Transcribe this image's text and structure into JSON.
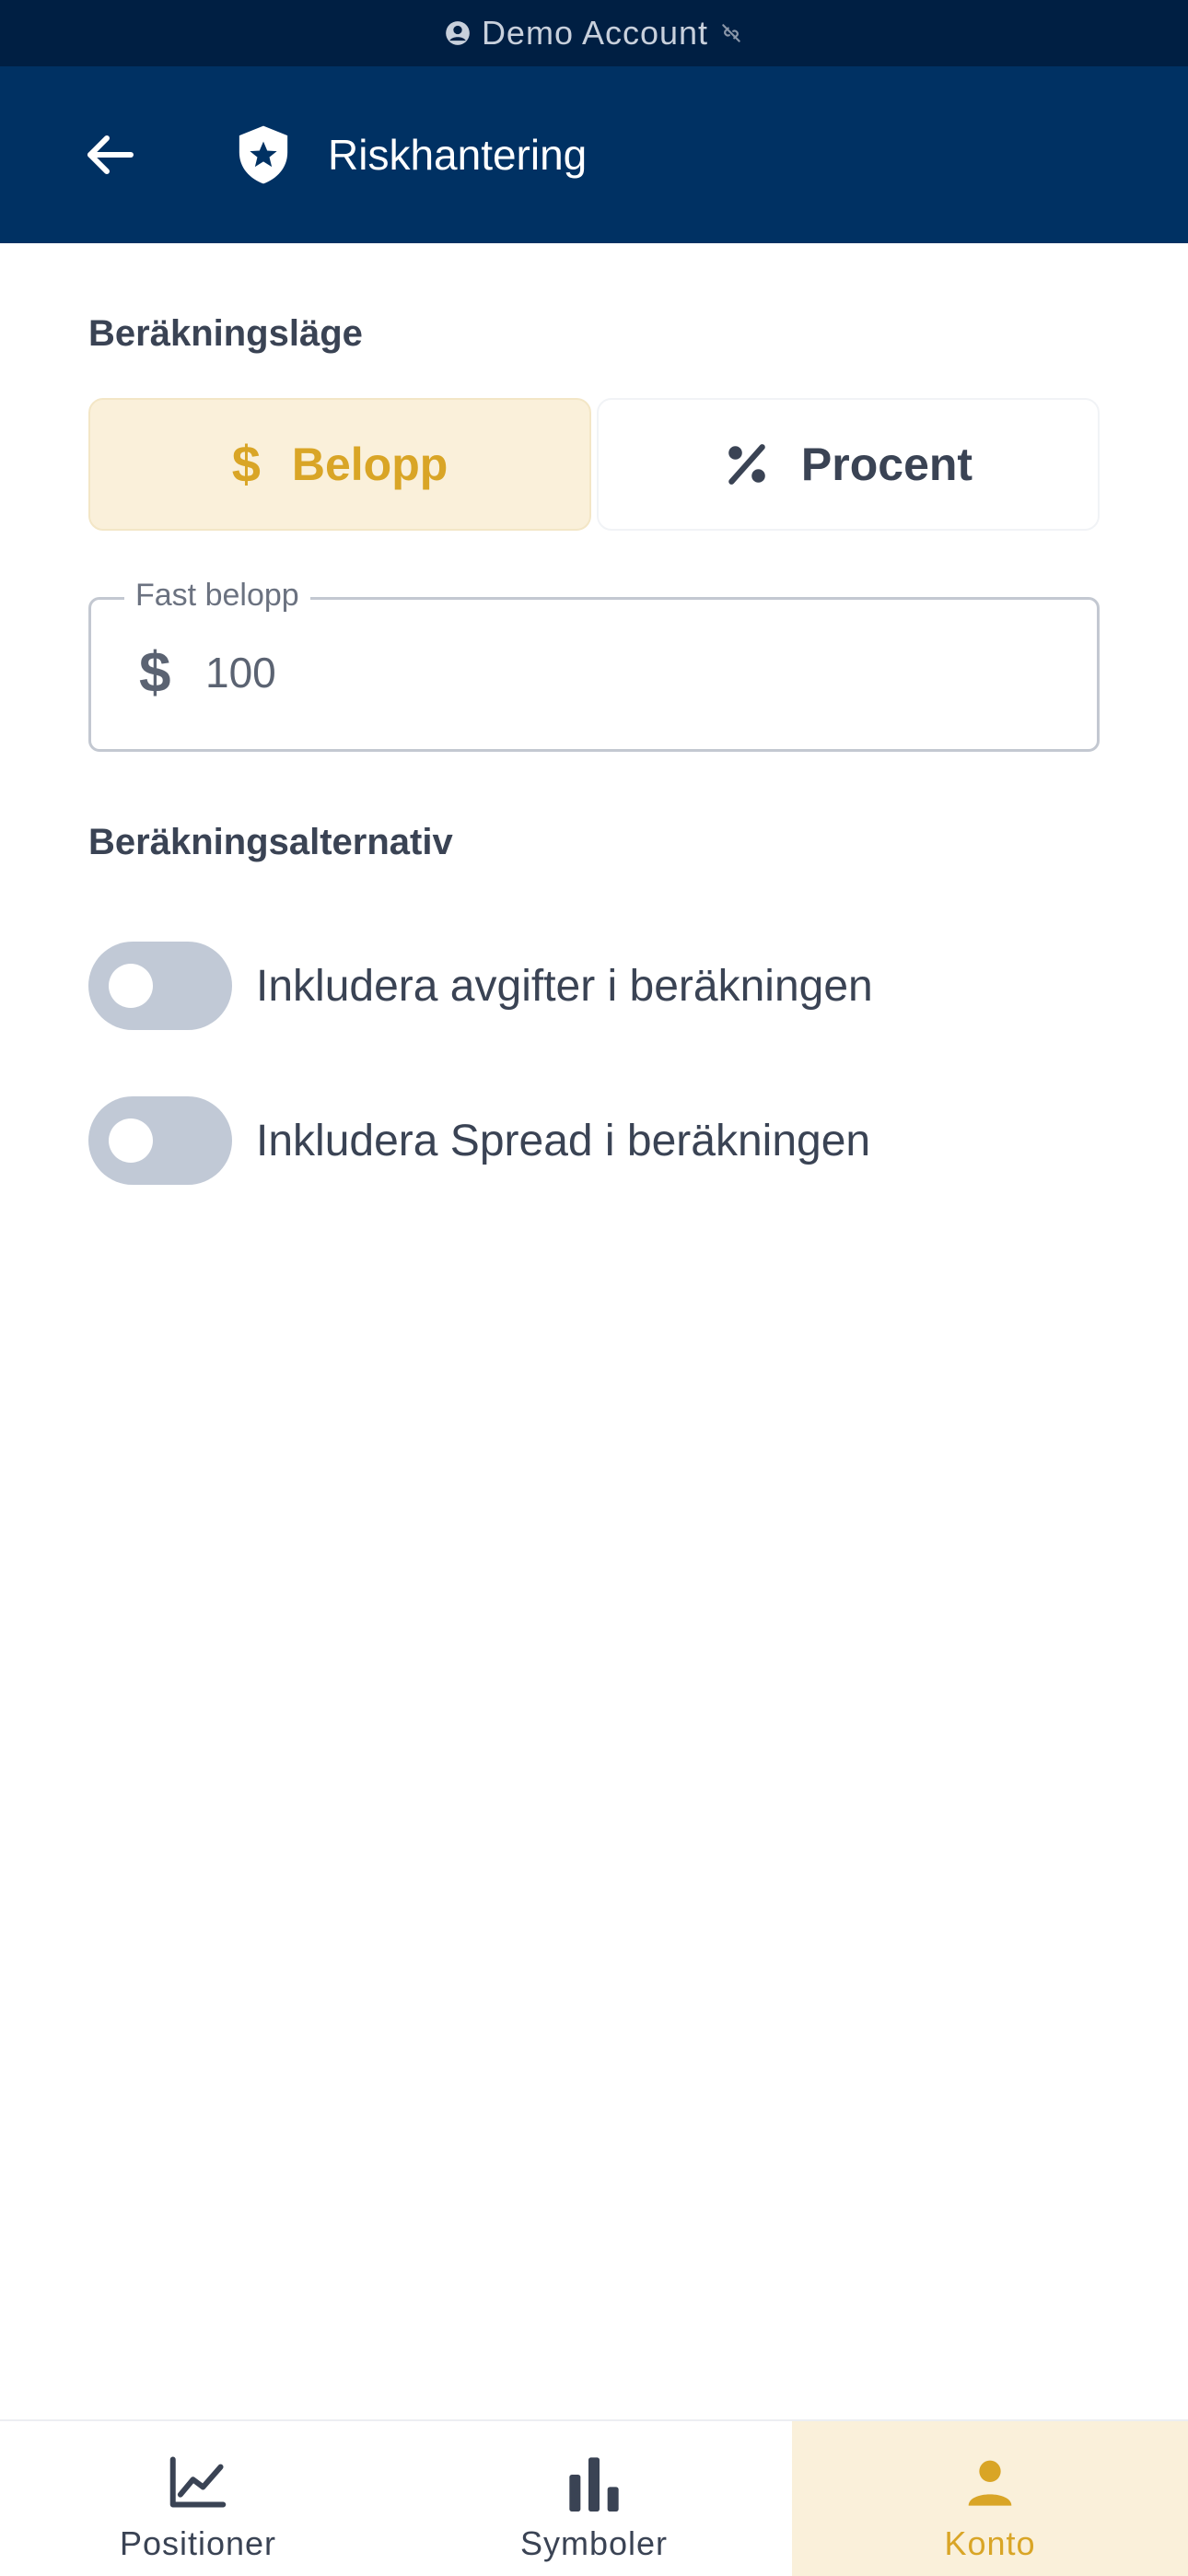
{
  "status_bar": {
    "label": "Demo Account",
    "icons": [
      "account-circle-icon",
      "link-off-icon"
    ]
  },
  "header": {
    "title": "Riskhantering",
    "back_icon": "arrow-left-icon",
    "title_icon": "shield-star-icon"
  },
  "calc_mode": {
    "title": "Beräkningsläge",
    "options": [
      {
        "label": "Belopp",
        "icon": "dollar-icon",
        "symbol": "$",
        "selected": true
      },
      {
        "label": "Procent",
        "icon": "percent-icon",
        "symbol": "%",
        "selected": false
      }
    ]
  },
  "amount_field": {
    "label": "Fast belopp",
    "prefix": "$",
    "value": "100"
  },
  "calc_options": {
    "title": "Beräkningsalternativ",
    "toggles": [
      {
        "label": "Inkludera avgifter i beräkningen",
        "on": false
      },
      {
        "label": "Inkludera Spread i beräkningen",
        "on": false
      }
    ]
  },
  "bottom_nav": {
    "items": [
      {
        "label": "Positioner",
        "icon": "chart-line-icon",
        "active": false
      },
      {
        "label": "Symboler",
        "icon": "bar-chart-icon",
        "active": false
      },
      {
        "label": "Konto",
        "icon": "person-icon",
        "active": true
      }
    ]
  },
  "colors": {
    "header_bg": "#003163",
    "status_bg": "#001f43",
    "accent": "#d9a526",
    "accent_bg": "#faf0da",
    "switch_off": "#c1c9d6"
  }
}
